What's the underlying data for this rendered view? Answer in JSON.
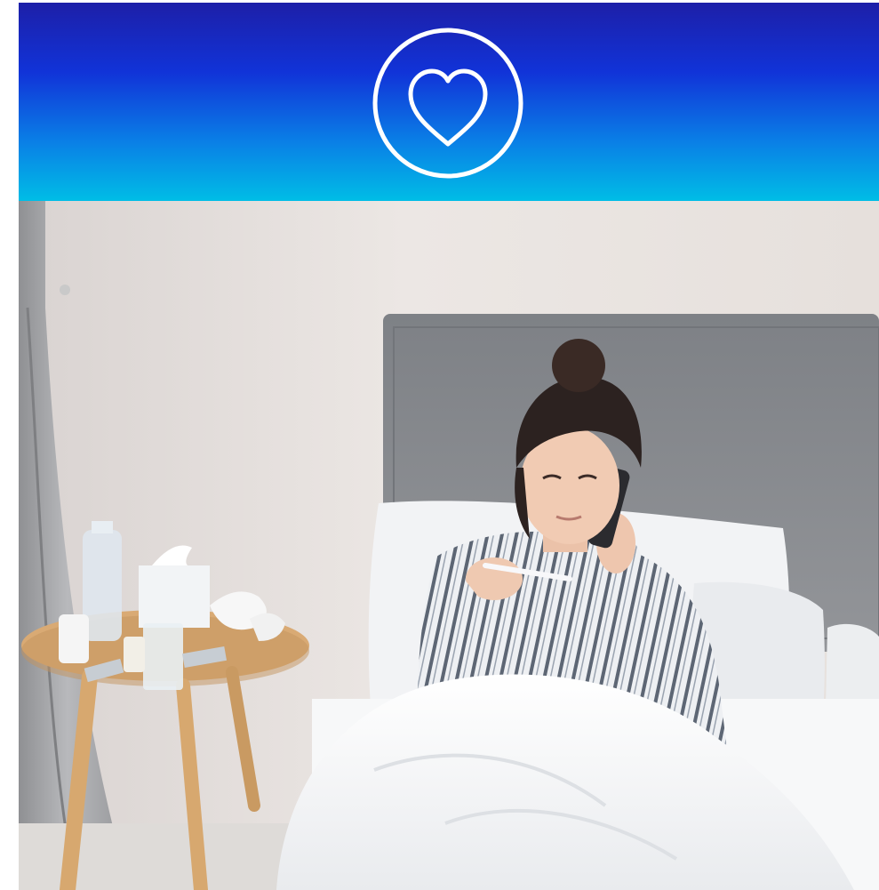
{
  "banner": {
    "icon": "heart-icon",
    "gradient_top": "#1d1fa8",
    "gradient_bottom": "#00bde6",
    "icon_color": "#ffffff"
  },
  "photo": {
    "subject": "person-on-phone-in-bed",
    "palette": {
      "wall": "#e9e3df",
      "headboard": "#8a8d92",
      "bedding": "#f6f6f7",
      "table": "#d9aa74",
      "curtain": "#a7a8ab"
    }
  }
}
